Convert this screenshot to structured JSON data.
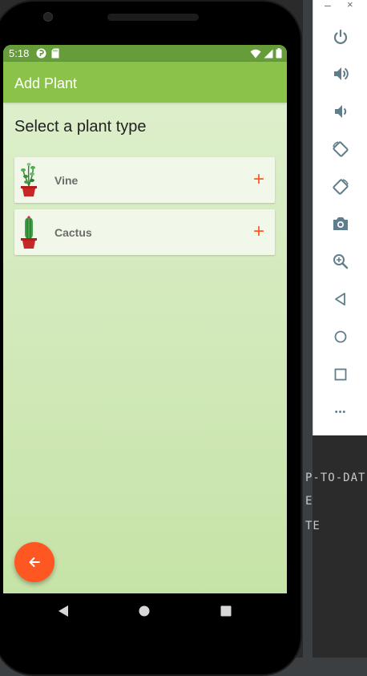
{
  "ide": {
    "lines": [
      "P-TO-DAT",
      "E",
      "TE"
    ]
  },
  "emulator_panel": {
    "minimize_label": "–",
    "close_label": "×",
    "buttons": [
      "power-icon",
      "volume-up-icon",
      "volume-down-icon",
      "rotate-left-icon",
      "rotate-right-icon",
      "camera-icon",
      "zoom-icon",
      "back-icon",
      "home-icon",
      "overview-icon",
      "more-icon"
    ],
    "more_label": "•••"
  },
  "status_bar": {
    "time": "5:18"
  },
  "app_bar": {
    "title": "Add Plant"
  },
  "main": {
    "heading": "Select a plant type",
    "plants": [
      {
        "label": "Vine",
        "add_label": "+"
      },
      {
        "label": "Cactus",
        "add_label": "+"
      }
    ]
  },
  "colors": {
    "status_bar": "#669c39",
    "app_bar": "#8bc34a",
    "accent": "#ff5722",
    "card": "#f1f8e9"
  }
}
